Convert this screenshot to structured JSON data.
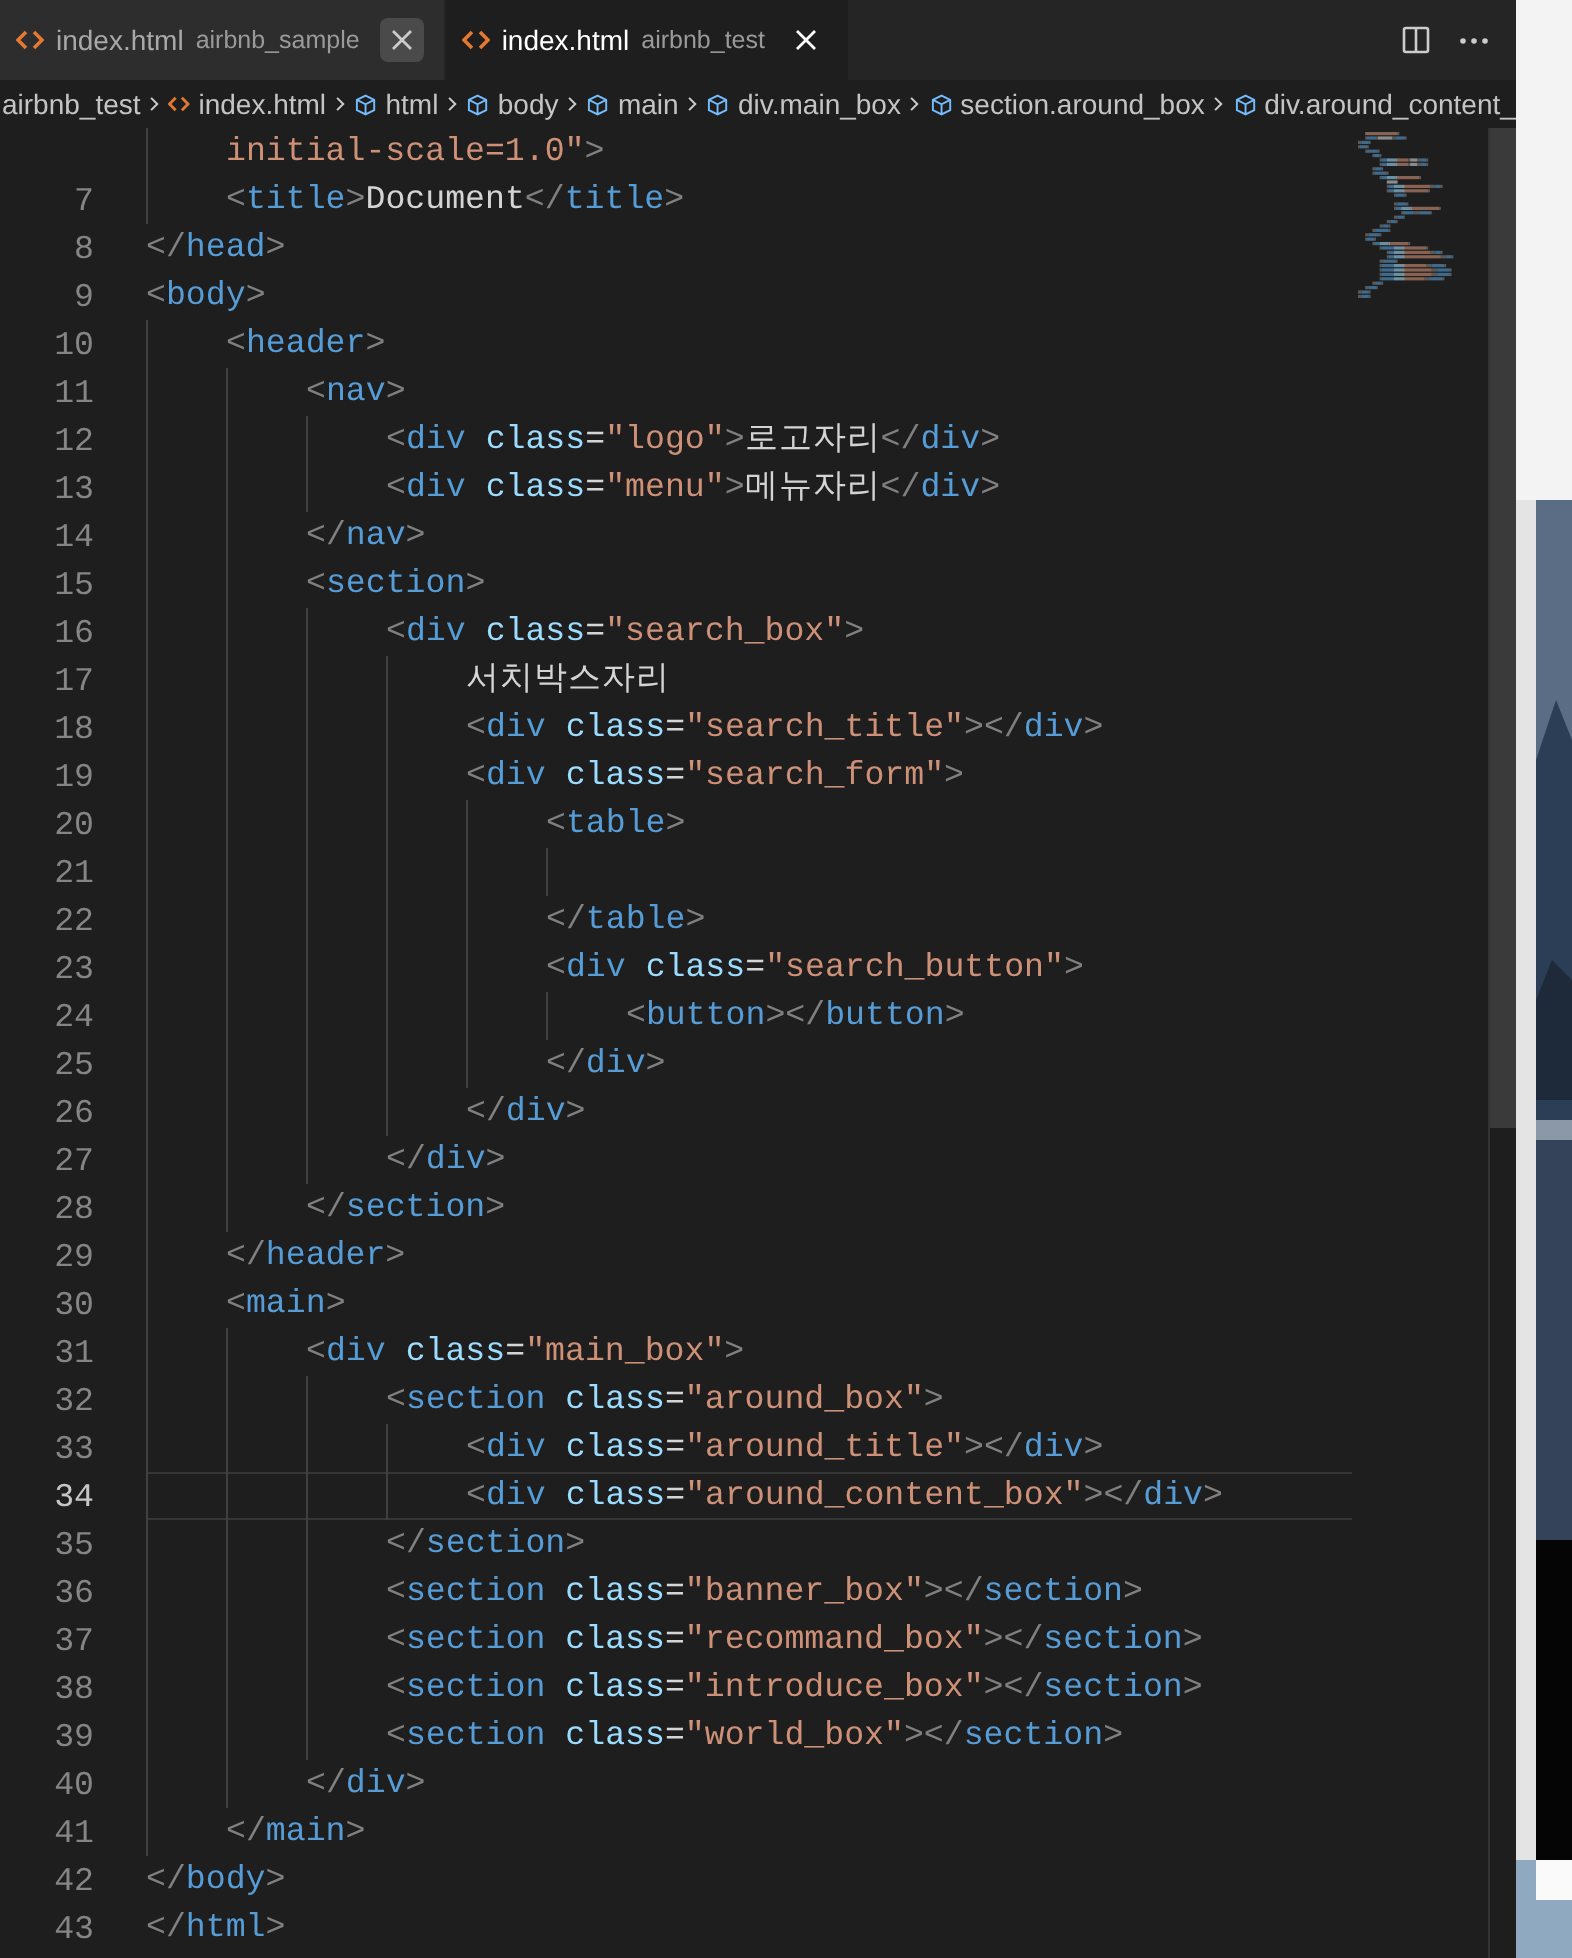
{
  "tabs": [
    {
      "label": "index.html",
      "description": "airbnb_sample",
      "selected": false
    },
    {
      "label": "index.html",
      "description": "airbnb_test",
      "selected": true
    }
  ],
  "breadcrumb": [
    {
      "label": "airbnb_test",
      "kind": "folder"
    },
    {
      "label": "index.html",
      "kind": "file"
    },
    {
      "label": "html",
      "kind": "element"
    },
    {
      "label": "body",
      "kind": "element"
    },
    {
      "label": "main",
      "kind": "element"
    },
    {
      "label": "div.main_box",
      "kind": "element"
    },
    {
      "label": "section.around_box",
      "kind": "element"
    },
    {
      "label": "div.around_content_",
      "kind": "element"
    }
  ],
  "lines": [
    {
      "children": [
        {
          "current": false,
          "tokens": [
            {
              "kind": "string",
              "text": "initial-scale=1.0\""
            },
            {
              "kind": "punct",
              "text": ">"
            }
          ]
        },
        {
          "number": "7",
          "current": false,
          "tokens": [
            {
              "kind": "punct",
              "text": "<"
            },
            {
              "kind": "tag",
              "text": "title"
            },
            {
              "kind": "punct",
              "text": ">"
            },
            {
              "kind": "text",
              "text": "Document"
            },
            {
              "kind": "punct",
              "text": "</"
            },
            {
              "kind": "tag",
              "text": "title"
            },
            {
              "kind": "punct",
              "text": ">"
            }
          ]
        }
      ]
    },
    {
      "number": "8",
      "current": false,
      "tokens": [
        {
          "kind": "punct",
          "text": "</"
        },
        {
          "kind": "tag",
          "text": "head"
        },
        {
          "kind": "punct",
          "text": ">"
        }
      ]
    },
    {
      "number": "9",
      "current": false,
      "tokens": [
        {
          "kind": "punct",
          "text": "<"
        },
        {
          "kind": "tag",
          "text": "body"
        },
        {
          "kind": "punct",
          "text": ">"
        }
      ],
      "children": [
        {
          "number": "10",
          "current": false,
          "tokens": [
            {
              "kind": "punct",
              "text": "<"
            },
            {
              "kind": "tag",
              "text": "header"
            },
            {
              "kind": "punct",
              "text": ">"
            }
          ],
          "children": [
            {
              "number": "11",
              "current": false,
              "tokens": [
                {
                  "kind": "punct",
                  "text": "<"
                },
                {
                  "kind": "tag",
                  "text": "nav"
                },
                {
                  "kind": "punct",
                  "text": ">"
                }
              ],
              "children": [
                {
                  "number": "12",
                  "current": false,
                  "tokens": [
                    {
                      "kind": "punct",
                      "text": "<"
                    },
                    {
                      "kind": "tag",
                      "text": "div"
                    },
                    {
                      "kind": "attr",
                      "text": "class"
                    },
                    {
                      "kind": "text",
                      "text": "="
                    },
                    {
                      "kind": "string",
                      "text": "\"logo\""
                    },
                    {
                      "kind": "punct",
                      "text": ">"
                    },
                    {
                      "kind": "text",
                      "text": "로고자리"
                    },
                    {
                      "kind": "punct",
                      "text": "</"
                    },
                    {
                      "kind": "tag",
                      "text": "div"
                    },
                    {
                      "kind": "punct",
                      "text": ">"
                    }
                  ]
                },
                {
                  "number": "13",
                  "current": false,
                  "tokens": [
                    {
                      "kind": "punct",
                      "text": "<"
                    },
                    {
                      "kind": "tag",
                      "text": "div"
                    },
                    {
                      "kind": "attr",
                      "text": "class"
                    },
                    {
                      "kind": "text",
                      "text": "="
                    },
                    {
                      "kind": "string",
                      "text": "\"menu\""
                    },
                    {
                      "kind": "punct",
                      "text": ">"
                    },
                    {
                      "kind": "text",
                      "text": "메뉴자리"
                    },
                    {
                      "kind": "punct",
                      "text": "</"
                    },
                    {
                      "kind": "tag",
                      "text": "div"
                    },
                    {
                      "kind": "punct",
                      "text": ">"
                    }
                  ]
                }
              ]
            },
            {
              "number": "14",
              "current": false,
              "tokens": [
                {
                  "kind": "punct",
                  "text": "</"
                },
                {
                  "kind": "tag",
                  "text": "nav"
                },
                {
                  "kind": "punct",
                  "text": ">"
                }
              ]
            },
            {
              "number": "15",
              "current": false,
              "tokens": [
                {
                  "kind": "punct",
                  "text": "<"
                },
                {
                  "kind": "tag",
                  "text": "section"
                },
                {
                  "kind": "punct",
                  "text": ">"
                }
              ],
              "children": [
                {
                  "number": "16",
                  "current": false,
                  "tokens": [
                    {
                      "kind": "punct",
                      "text": "<"
                    },
                    {
                      "kind": "tag",
                      "text": "div"
                    },
                    {
                      "kind": "attr",
                      "text": "class"
                    },
                    {
                      "kind": "text",
                      "text": "="
                    },
                    {
                      "kind": "string",
                      "text": "\"search_box\""
                    },
                    {
                      "kind": "punct",
                      "text": ">"
                    }
                  ],
                  "children": [
                    {
                      "number": "17",
                      "current": false,
                      "tokens": [
                        {
                          "kind": "text",
                          "text": "서치박스자리"
                        }
                      ]
                    },
                    {
                      "number": "18",
                      "current": false,
                      "tokens": [
                        {
                          "kind": "punct",
                          "text": "<"
                        },
                        {
                          "kind": "tag",
                          "text": "div"
                        },
                        {
                          "kind": "attr",
                          "text": "class"
                        },
                        {
                          "kind": "text",
                          "text": "="
                        },
                        {
                          "kind": "string",
                          "text": "\"search_title\""
                        },
                        {
                          "kind": "punct",
                          "text": "></"
                        },
                        {
                          "kind": "tag",
                          "text": "div"
                        },
                        {
                          "kind": "punct",
                          "text": ">"
                        }
                      ]
                    },
                    {
                      "number": "19",
                      "current": false,
                      "tokens": [
                        {
                          "kind": "punct",
                          "text": "<"
                        },
                        {
                          "kind": "tag",
                          "text": "div"
                        },
                        {
                          "kind": "attr",
                          "text": "class"
                        },
                        {
                          "kind": "text",
                          "text": "="
                        },
                        {
                          "kind": "string",
                          "text": "\"search_form\""
                        },
                        {
                          "kind": "punct",
                          "text": ">"
                        }
                      ],
                      "children": [
                        {
                          "number": "20",
                          "current": false,
                          "tokens": [
                            {
                              "kind": "punct",
                              "text": "<"
                            },
                            {
                              "kind": "tag",
                              "text": "table"
                            },
                            {
                              "kind": "punct",
                              "text": ">"
                            }
                          ],
                          "children": [
                            {
                              "number": "21",
                              "current": false
                            }
                          ]
                        },
                        {
                          "number": "22",
                          "current": false,
                          "tokens": [
                            {
                              "kind": "punct",
                              "text": "</"
                            },
                            {
                              "kind": "tag",
                              "text": "table"
                            },
                            {
                              "kind": "punct",
                              "text": ">"
                            }
                          ]
                        },
                        {
                          "number": "23",
                          "current": false,
                          "tokens": [
                            {
                              "kind": "punct",
                              "text": "<"
                            },
                            {
                              "kind": "tag",
                              "text": "div"
                            },
                            {
                              "kind": "attr",
                              "text": "class"
                            },
                            {
                              "kind": "text",
                              "text": "="
                            },
                            {
                              "kind": "string",
                              "text": "\"search_button\""
                            },
                            {
                              "kind": "punct",
                              "text": ">"
                            }
                          ],
                          "children": [
                            {
                              "number": "24",
                              "current": false,
                              "tokens": [
                                {
                                  "kind": "punct",
                                  "text": "<"
                                },
                                {
                                  "kind": "tag",
                                  "text": "button"
                                },
                                {
                                  "kind": "punct",
                                  "text": "></"
                                },
                                {
                                  "kind": "tag",
                                  "text": "button"
                                },
                                {
                                  "kind": "punct",
                                  "text": ">"
                                }
                              ]
                            }
                          ]
                        },
                        {
                          "number": "25",
                          "current": false,
                          "tokens": [
                            {
                              "kind": "punct",
                              "text": "</"
                            },
                            {
                              "kind": "tag",
                              "text": "div"
                            },
                            {
                              "kind": "punct",
                              "text": ">"
                            }
                          ]
                        }
                      ]
                    },
                    {
                      "number": "26",
                      "current": false,
                      "tokens": [
                        {
                          "kind": "punct",
                          "text": "</"
                        },
                        {
                          "kind": "tag",
                          "text": "div"
                        },
                        {
                          "kind": "punct",
                          "text": ">"
                        }
                      ]
                    }
                  ]
                },
                {
                  "number": "27",
                  "current": false,
                  "tokens": [
                    {
                      "kind": "punct",
                      "text": "</"
                    },
                    {
                      "kind": "tag",
                      "text": "div"
                    },
                    {
                      "kind": "punct",
                      "text": ">"
                    }
                  ]
                }
              ]
            },
            {
              "number": "28",
              "current": false,
              "tokens": [
                {
                  "kind": "punct",
                  "text": "</"
                },
                {
                  "kind": "tag",
                  "text": "section"
                },
                {
                  "kind": "punct",
                  "text": ">"
                }
              ]
            }
          ]
        },
        {
          "number": "29",
          "current": false,
          "tokens": [
            {
              "kind": "punct",
              "text": "</"
            },
            {
              "kind": "tag",
              "text": "header"
            },
            {
              "kind": "punct",
              "text": ">"
            }
          ]
        },
        {
          "number": "30",
          "current": false,
          "tokens": [
            {
              "kind": "punct",
              "text": "<"
            },
            {
              "kind": "tag",
              "text": "main"
            },
            {
              "kind": "punct",
              "text": ">"
            }
          ],
          "children": [
            {
              "number": "31",
              "current": false,
              "tokens": [
                {
                  "kind": "punct",
                  "text": "<"
                },
                {
                  "kind": "tag",
                  "text": "div"
                },
                {
                  "kind": "attr",
                  "text": "class"
                },
                {
                  "kind": "text",
                  "text": "="
                },
                {
                  "kind": "string",
                  "text": "\"main_box\""
                },
                {
                  "kind": "punct",
                  "text": ">"
                }
              ],
              "children": [
                {
                  "number": "32",
                  "current": false,
                  "tokens": [
                    {
                      "kind": "punct",
                      "text": "<"
                    },
                    {
                      "kind": "tag",
                      "text": "section"
                    },
                    {
                      "kind": "attr",
                      "text": "class"
                    },
                    {
                      "kind": "text",
                      "text": "="
                    },
                    {
                      "kind": "string",
                      "text": "\"around_box\""
                    },
                    {
                      "kind": "punct",
                      "text": ">"
                    }
                  ],
                  "children": [
                    {
                      "number": "33",
                      "current": false,
                      "tokens": [
                        {
                          "kind": "punct",
                          "text": "<"
                        },
                        {
                          "kind": "tag",
                          "text": "div"
                        },
                        {
                          "kind": "attr",
                          "text": "class"
                        },
                        {
                          "kind": "text",
                          "text": "="
                        },
                        {
                          "kind": "string",
                          "text": "\"around_title\""
                        },
                        {
                          "kind": "punct",
                          "text": "></"
                        },
                        {
                          "kind": "tag",
                          "text": "div"
                        },
                        {
                          "kind": "punct",
                          "text": ">"
                        }
                      ]
                    },
                    {
                      "number": "34",
                      "current": true,
                      "tokens": [
                        {
                          "kind": "punct",
                          "text": "<"
                        },
                        {
                          "kind": "tag",
                          "text": "div"
                        },
                        {
                          "kind": "attr",
                          "text": "class"
                        },
                        {
                          "kind": "text",
                          "text": "="
                        },
                        {
                          "kind": "string",
                          "text": "\"around_content_box\""
                        },
                        {
                          "kind": "punct",
                          "text": "></"
                        },
                        {
                          "kind": "tag",
                          "text": "div"
                        },
                        {
                          "kind": "punct",
                          "text": ">"
                        }
                      ]
                    }
                  ]
                },
                {
                  "number": "35",
                  "current": false,
                  "tokens": [
                    {
                      "kind": "punct",
                      "text": "</"
                    },
                    {
                      "kind": "tag",
                      "text": "section"
                    },
                    {
                      "kind": "punct",
                      "text": ">"
                    }
                  ]
                },
                {
                  "number": "36",
                  "current": false,
                  "tokens": [
                    {
                      "kind": "punct",
                      "text": "<"
                    },
                    {
                      "kind": "tag",
                      "text": "section"
                    },
                    {
                      "kind": "attr",
                      "text": "class"
                    },
                    {
                      "kind": "text",
                      "text": "="
                    },
                    {
                      "kind": "string",
                      "text": "\"banner_box\""
                    },
                    {
                      "kind": "punct",
                      "text": "></"
                    },
                    {
                      "kind": "tag",
                      "text": "section"
                    },
                    {
                      "kind": "punct",
                      "text": ">"
                    }
                  ]
                },
                {
                  "number": "37",
                  "current": false,
                  "tokens": [
                    {
                      "kind": "punct",
                      "text": "<"
                    },
                    {
                      "kind": "tag",
                      "text": "section"
                    },
                    {
                      "kind": "attr",
                      "text": "class"
                    },
                    {
                      "kind": "text",
                      "text": "="
                    },
                    {
                      "kind": "string",
                      "text": "\"recommand_box\""
                    },
                    {
                      "kind": "punct",
                      "text": "></"
                    },
                    {
                      "kind": "tag",
                      "text": "section"
                    },
                    {
                      "kind": "punct",
                      "text": ">"
                    }
                  ]
                },
                {
                  "number": "38",
                  "current": false,
                  "tokens": [
                    {
                      "kind": "punct",
                      "text": "<"
                    },
                    {
                      "kind": "tag",
                      "text": "section"
                    },
                    {
                      "kind": "attr",
                      "text": "class"
                    },
                    {
                      "kind": "text",
                      "text": "="
                    },
                    {
                      "kind": "string",
                      "text": "\"introduce_box\""
                    },
                    {
                      "kind": "punct",
                      "text": "></"
                    },
                    {
                      "kind": "tag",
                      "text": "section"
                    },
                    {
                      "kind": "punct",
                      "text": ">"
                    }
                  ]
                },
                {
                  "number": "39",
                  "current": false,
                  "tokens": [
                    {
                      "kind": "punct",
                      "text": "<"
                    },
                    {
                      "kind": "tag",
                      "text": "section"
                    },
                    {
                      "kind": "attr",
                      "text": "class"
                    },
                    {
                      "kind": "text",
                      "text": "="
                    },
                    {
                      "kind": "string",
                      "text": "\"world_box\""
                    },
                    {
                      "kind": "punct",
                      "text": "></"
                    },
                    {
                      "kind": "tag",
                      "text": "section"
                    },
                    {
                      "kind": "punct",
                      "text": ">"
                    }
                  ]
                }
              ]
            },
            {
              "number": "40",
              "current": false,
              "tokens": [
                {
                  "kind": "punct",
                  "text": "</"
                },
                {
                  "kind": "tag",
                  "text": "div"
                },
                {
                  "kind": "punct",
                  "text": ">"
                }
              ]
            }
          ]
        },
        {
          "number": "41",
          "current": false,
          "tokens": [
            {
              "kind": "punct",
              "text": "</"
            },
            {
              "kind": "tag",
              "text": "main"
            },
            {
              "kind": "punct",
              "text": ">"
            }
          ]
        }
      ]
    },
    {
      "number": "42",
      "current": false,
      "tokens": [
        {
          "kind": "punct",
          "text": "</"
        },
        {
          "kind": "tag",
          "text": "body"
        },
        {
          "kind": "punct",
          "text": ">"
        }
      ]
    },
    {
      "number": "43",
      "current": false,
      "tokens": [
        {
          "kind": "punct",
          "text": "</"
        },
        {
          "kind": "tag",
          "text": "html"
        },
        {
          "kind": "punct",
          "text": ">"
        }
      ]
    }
  ]
}
